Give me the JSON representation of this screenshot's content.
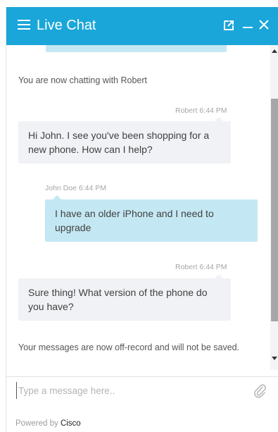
{
  "header": {
    "title": "Live Chat"
  },
  "messages": {
    "connected_notice": "You are now chatting with Robert",
    "items": [
      {
        "sender": "Robert",
        "time": "6:44 PM",
        "meta": "Robert 6:44 PM",
        "text": "Hi John. I see you've been shopping for a new phone. How can I help?"
      },
      {
        "sender": "John Doe",
        "time": "6:44 PM",
        "meta": "John Doe 6:44 PM",
        "text": "I have an older iPhone and I need to upgrade"
      },
      {
        "sender": "Robert",
        "time": "6:44 PM",
        "meta": "Robert 6:44 PM",
        "text": "Sure thing! What version of the phone do you have?"
      }
    ],
    "offrecord_notice": "Your messages are now off-record and will not be saved."
  },
  "composer": {
    "placeholder": "Type a message here..",
    "value": ""
  },
  "footer": {
    "powered_prefix": "Powered by",
    "brand": "Cisco"
  },
  "colors": {
    "header_bg": "#1ba6d9",
    "agent_bubble": "#f0f2f5",
    "user_bubble": "#c4e8f3"
  },
  "icons": [
    "menu-icon",
    "popout-icon",
    "minimize-icon",
    "close-icon",
    "paperclip-icon"
  ]
}
